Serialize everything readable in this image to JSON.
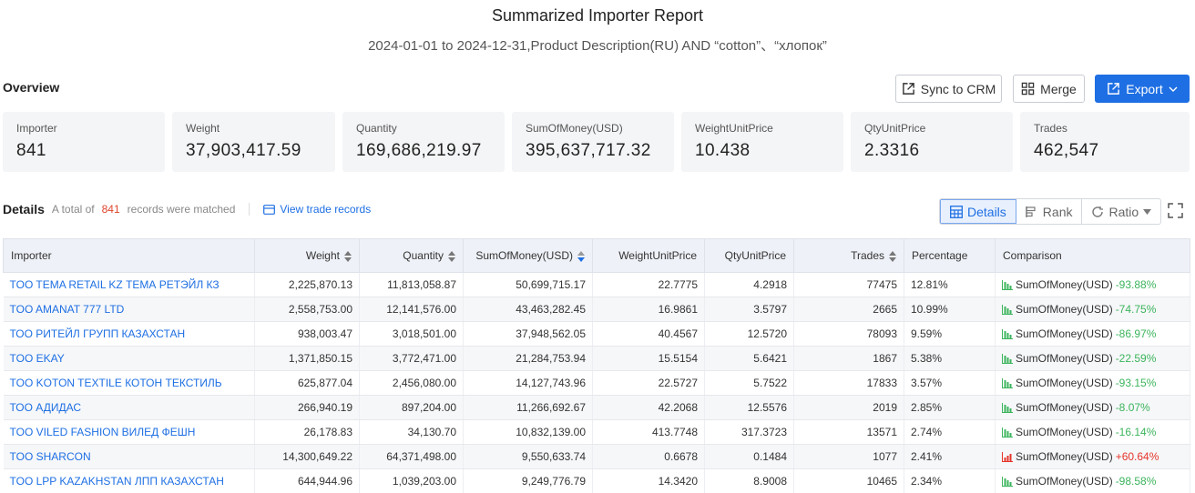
{
  "report": {
    "title": "Summarized Importer Report",
    "subtitle": "2024-01-01 to 2024-12-31,Product Description(RU) AND “cotton”、“хлопок”"
  },
  "overview": {
    "label": "Overview",
    "buttons": {
      "sync": "Sync to CRM",
      "merge": "Merge",
      "export": "Export"
    },
    "stats": [
      {
        "label": "Importer",
        "value": "841"
      },
      {
        "label": "Weight",
        "value": "37,903,417.59"
      },
      {
        "label": "Quantity",
        "value": "169,686,219.97"
      },
      {
        "label": "SumOfMoney(USD)",
        "value": "395,637,717.32"
      },
      {
        "label": "WeightUnitPrice",
        "value": "10.438"
      },
      {
        "label": "QtyUnitPrice",
        "value": "2.3316"
      },
      {
        "label": "Trades",
        "value": "462,547"
      }
    ]
  },
  "details": {
    "title": "Details",
    "total_prefix": "A total of",
    "total_count": "841",
    "total_suffix": "records were matched",
    "view_link": "View trade records",
    "toggles": {
      "details": "Details",
      "rank": "Rank",
      "ratio": "Ratio"
    }
  },
  "table": {
    "headers": [
      "Importer",
      "Weight",
      "Quantity",
      "SumOfMoney(USD)",
      "WeightUnitPrice",
      "QtyUnitPrice",
      "Trades",
      "Percentage",
      "Comparison"
    ],
    "rows": [
      {
        "importer": "TOO TEMA RETAIL KZ ТЕМА РЕТЭЙЛ КЗ",
        "weight": "2,225,870.13",
        "quantity": "11,813,058.87",
        "money": "50,699,715.17",
        "wup": "22.7775",
        "qup": "4.2918",
        "trades": "77475",
        "pct": "12.81%",
        "cmp_label": "SumOfMoney(USD)",
        "cmp_value": "-93.88%",
        "cmp_dir": "down"
      },
      {
        "importer": "TOO AMANAT 777 LTD",
        "weight": "2,558,753.00",
        "quantity": "12,141,576.00",
        "money": "43,463,282.45",
        "wup": "16.9861",
        "qup": "3.5797",
        "trades": "2665",
        "pct": "10.99%",
        "cmp_label": "SumOfMoney(USD)",
        "cmp_value": "-74.75%",
        "cmp_dir": "down"
      },
      {
        "importer": "ТОО РИТЕЙЛ ГРУПП КАЗАХСТАН",
        "weight": "938,003.47",
        "quantity": "3,018,501.00",
        "money": "37,948,562.05",
        "wup": "40.4567",
        "qup": "12.5720",
        "trades": "78093",
        "pct": "9.59%",
        "cmp_label": "SumOfMoney(USD)",
        "cmp_value": "-86.97%",
        "cmp_dir": "down"
      },
      {
        "importer": "TOO EKAY",
        "weight": "1,371,850.15",
        "quantity": "3,772,471.00",
        "money": "21,284,753.94",
        "wup": "15.5154",
        "qup": "5.6421",
        "trades": "1867",
        "pct": "5.38%",
        "cmp_label": "SumOfMoney(USD)",
        "cmp_value": "-22.59%",
        "cmp_dir": "down"
      },
      {
        "importer": "TOO KOTON TEXTILE КОТОН ТЕКСТИЛЬ",
        "weight": "625,877.04",
        "quantity": "2,456,080.00",
        "money": "14,127,743.96",
        "wup": "22.5727",
        "qup": "5.7522",
        "trades": "17833",
        "pct": "3.57%",
        "cmp_label": "SumOfMoney(USD)",
        "cmp_value": "-93.15%",
        "cmp_dir": "down"
      },
      {
        "importer": "ТОО АДИДАС",
        "weight": "266,940.19",
        "quantity": "897,204.00",
        "money": "11,266,692.67",
        "wup": "42.2068",
        "qup": "12.5576",
        "trades": "2019",
        "pct": "2.85%",
        "cmp_label": "SumOfMoney(USD)",
        "cmp_value": "-8.07%",
        "cmp_dir": "down"
      },
      {
        "importer": "TOO VILED FASHION ВИЛЕД ФЕШН",
        "weight": "26,178.83",
        "quantity": "34,130.70",
        "money": "10,832,139.00",
        "wup": "413.7748",
        "qup": "317.3723",
        "trades": "13571",
        "pct": "2.74%",
        "cmp_label": "SumOfMoney(USD)",
        "cmp_value": "-16.14%",
        "cmp_dir": "down"
      },
      {
        "importer": "TOO SHARCON",
        "weight": "14,300,649.22",
        "quantity": "64,371,498.00",
        "money": "9,550,633.74",
        "wup": "0.6678",
        "qup": "0.1484",
        "trades": "1077",
        "pct": "2.41%",
        "cmp_label": "SumOfMoney(USD)",
        "cmp_value": "+60.64%",
        "cmp_dir": "up"
      },
      {
        "importer": "TOO LPP KAZAKHSTAN ЛПП КАЗАХСТАН",
        "weight": "644,944.96",
        "quantity": "1,039,203.00",
        "money": "9,249,776.79",
        "wup": "14.3420",
        "qup": "8.9008",
        "trades": "10465",
        "pct": "2.34%",
        "cmp_label": "SumOfMoney(USD)",
        "cmp_value": "-98.58%",
        "cmp_dir": "down"
      }
    ]
  },
  "colors": {
    "accent": "#1e6fe3",
    "down": "#3cb45c",
    "up": "#e5352b"
  }
}
